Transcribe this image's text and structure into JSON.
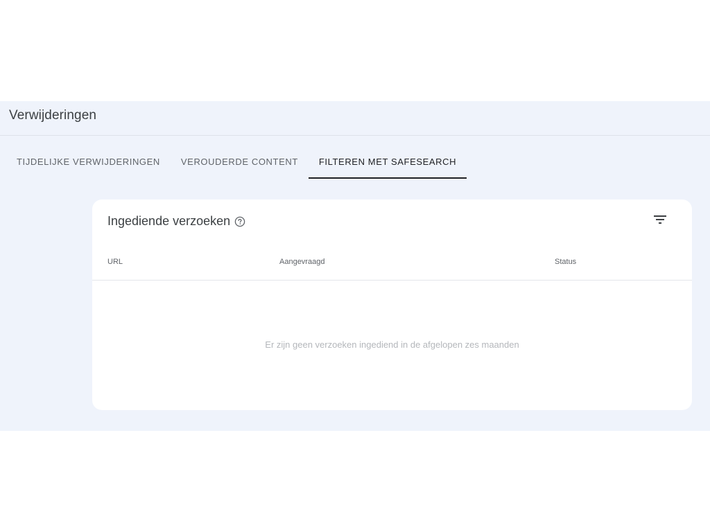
{
  "page": {
    "title": "Verwijderingen"
  },
  "tabs": [
    {
      "label": "TIJDELIJKE VERWIJDERINGEN",
      "active": false
    },
    {
      "label": "VEROUDERDE CONTENT",
      "active": false
    },
    {
      "label": "FILTEREN MET SAFESEARCH",
      "active": true
    }
  ],
  "card": {
    "title": "Ingediende verzoeken",
    "help_icon": "help-circle-icon",
    "filter_icon": "filter-list-icon",
    "columns": [
      "URL",
      "Aangevraagd",
      "Status"
    ],
    "empty_message": "Er zijn geen verzoeken ingediend in de afgelopen zes maanden"
  },
  "colors": {
    "background": "#eff3fb",
    "card": "#ffffff",
    "active_tab_indicator": "#202124",
    "muted_text": "#b4b7bb"
  }
}
